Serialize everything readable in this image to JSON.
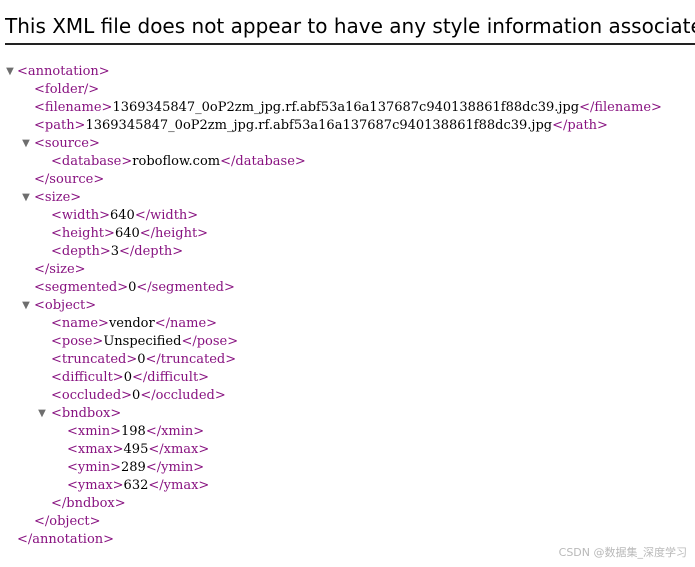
{
  "header": {
    "message": "This XML file does not appear to have any style information associated with it. The document tree is shown below."
  },
  "tree": {
    "annotation_open": "<annotation>",
    "folder": "<folder/>",
    "filename_open": "<filename>",
    "filename_value": "1369345847_0oP2zm_jpg.rf.abf53a16a137687c940138861f88dc39.jpg",
    "filename_close": "</filename>",
    "path_open": "<path>",
    "path_value": "1369345847_0oP2zm_jpg.rf.abf53a16a137687c940138861f88dc39.jpg",
    "path_close": "</path>",
    "source_open": "<source>",
    "database_open": "<database>",
    "database_value": "roboflow.com",
    "database_close": "</database>",
    "source_close": "</source>",
    "size_open": "<size>",
    "width_open": "<width>",
    "width_value": "640",
    "width_close": "</width>",
    "height_open": "<height>",
    "height_value": "640",
    "height_close": "</height>",
    "depth_open": "<depth>",
    "depth_value": "3",
    "depth_close": "</depth>",
    "size_close": "</size>",
    "segmented_open": "<segmented>",
    "segmented_value": "0",
    "segmented_close": "</segmented>",
    "object_open": "<object>",
    "name_open": "<name>",
    "name_value": "vendor",
    "name_close": "</name>",
    "pose_open": "<pose>",
    "pose_value": "Unspecified",
    "pose_close": "</pose>",
    "truncated_open": "<truncated>",
    "truncated_value": "0",
    "truncated_close": "</truncated>",
    "difficult_open": "<difficult>",
    "difficult_value": "0",
    "difficult_close": "</difficult>",
    "occluded_open": "<occluded>",
    "occluded_value": "0",
    "occluded_close": "</occluded>",
    "bndbox_open": "<bndbox>",
    "xmin_open": "<xmin>",
    "xmin_value": "198",
    "xmin_close": "</xmin>",
    "xmax_open": "<xmax>",
    "xmax_value": "495",
    "xmax_close": "</xmax>",
    "ymin_open": "<ymin>",
    "ymin_value": "289",
    "ymin_close": "</ymin>",
    "ymax_open": "<ymax>",
    "ymax_value": "632",
    "ymax_close": "</ymax>",
    "bndbox_close": "</bndbox>",
    "object_close": "</object>",
    "annotation_close": "</annotation>"
  },
  "icons": {
    "expand_toggle": "triangle-down-icon"
  },
  "watermark": {
    "text": "CSDN @数据集_深度学习"
  },
  "colors": {
    "tag": "#881280",
    "text": "#000000",
    "toggle": "#6e6e6e"
  }
}
